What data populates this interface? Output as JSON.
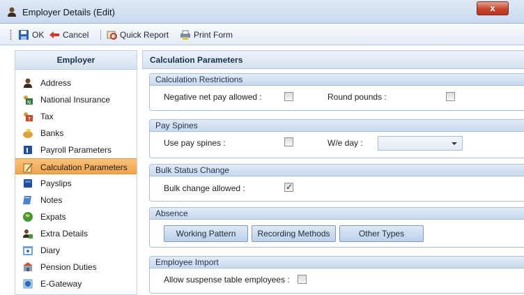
{
  "window": {
    "title": "Employer Details (Edit)",
    "close_label": "x"
  },
  "toolbar": {
    "ok": "OK",
    "cancel": "Cancel",
    "quick_report": "Quick Report",
    "print_form": "Print Form"
  },
  "sidebar": {
    "header": "Employer",
    "items": [
      {
        "label": "Address",
        "icon": "people-icon"
      },
      {
        "label": "National Insurance",
        "icon": "ni-icon"
      },
      {
        "label": "Tax",
        "icon": "tax-icon"
      },
      {
        "label": "Banks",
        "icon": "piggy-bank-icon"
      },
      {
        "label": "Payroll Parameters",
        "icon": "book-icon"
      },
      {
        "label": "Calculation Parameters",
        "icon": "pencil-note-icon",
        "active": true
      },
      {
        "label": "Payslips",
        "icon": "book-icon"
      },
      {
        "label": "Notes",
        "icon": "notepad-icon"
      },
      {
        "label": "Expats",
        "icon": "globe-icon"
      },
      {
        "label": "Extra Details",
        "icon": "people-icon"
      },
      {
        "label": "Diary",
        "icon": "diary-icon"
      },
      {
        "label": "Pension Duties",
        "icon": "pension-icon"
      },
      {
        "label": "E-Gateway",
        "icon": "gateway-icon"
      }
    ]
  },
  "main": {
    "header": "Calculation Parameters",
    "restrictions": {
      "title": "Calculation Restrictions",
      "negative_label": "Negative net pay allowed :",
      "negative_checked": false,
      "round_label": "Round pounds :",
      "round_checked": false
    },
    "pay_spines": {
      "title": "Pay Spines",
      "use_label": "Use pay spines :",
      "use_checked": false,
      "we_day_label": "W/e day :",
      "we_day_value": ""
    },
    "bulk": {
      "title": "Bulk Status Change",
      "allowed_label": "Bulk change allowed :",
      "allowed_checked": true,
      "check_mark": "✓"
    },
    "absence": {
      "title": "Absence",
      "buttons": [
        "Working Pattern",
        "Recording Methods",
        "Other Types"
      ]
    },
    "import": {
      "title": "Employee Import",
      "suspense_label": "Allow suspense table employees :",
      "suspense_checked": false
    }
  },
  "colors": {
    "active_item": "#f2a34a",
    "header_blue": "#15304f",
    "close_red": "#c7442b"
  }
}
